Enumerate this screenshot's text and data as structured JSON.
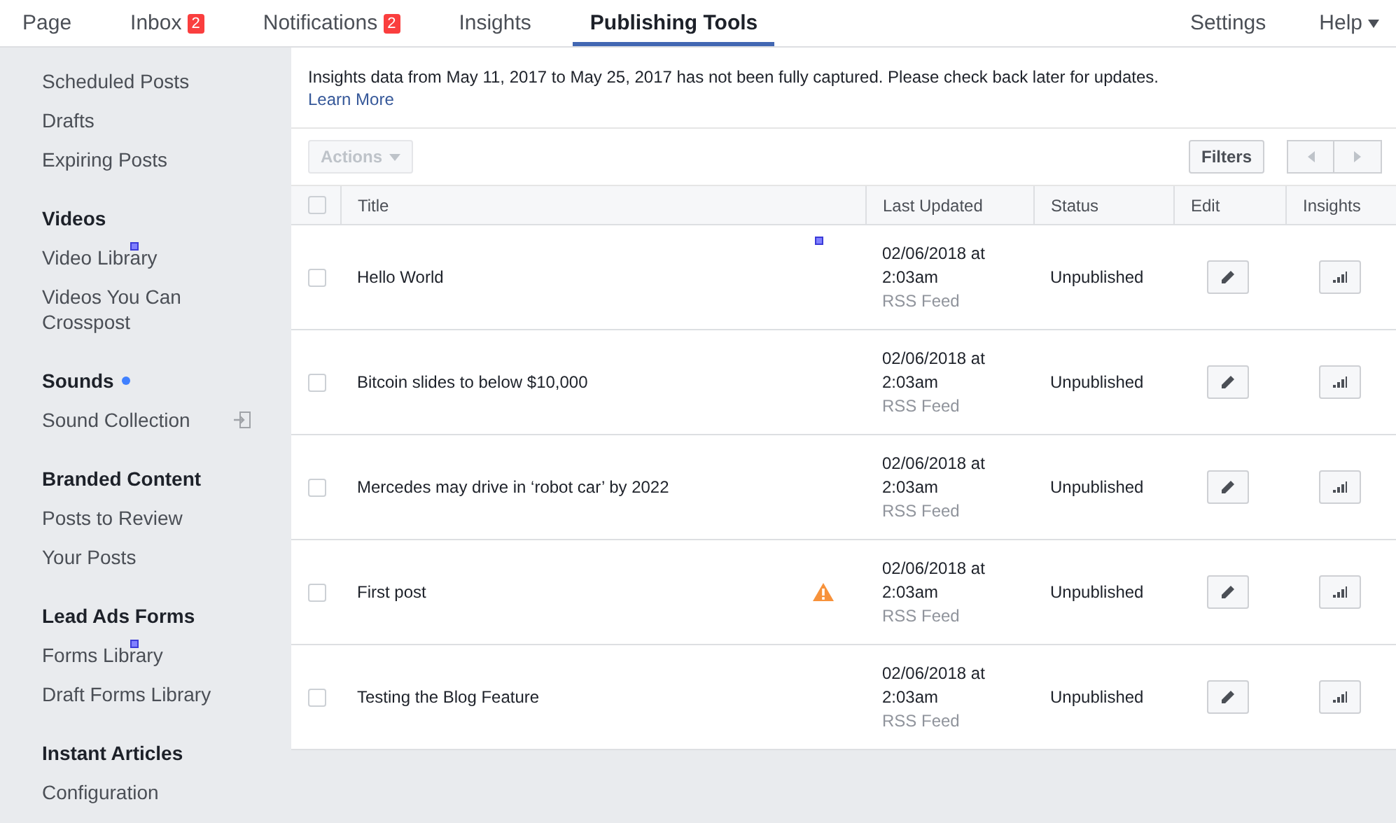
{
  "nav": {
    "tabs": [
      {
        "label": "Page",
        "selected": false
      },
      {
        "label": "Inbox",
        "badge": "2",
        "selected": false
      },
      {
        "label": "Notifications",
        "badge": "2",
        "selected": false
      },
      {
        "label": "Insights",
        "selected": false
      },
      {
        "label": "Publishing Tools",
        "selected": true
      }
    ],
    "right": [
      {
        "label": "Settings",
        "kind": "plain"
      },
      {
        "label": "Help",
        "kind": "menu"
      }
    ]
  },
  "sidebar": {
    "sections": [
      {
        "items": [
          {
            "label": "Scheduled Posts",
            "marker": false
          },
          {
            "label": "Drafts",
            "marker": false
          },
          {
            "label": "Expiring Posts",
            "marker": false
          }
        ]
      },
      {
        "heading": "Videos",
        "new_dot": false,
        "items": [
          {
            "label": "Video Library",
            "marker": true
          },
          {
            "label": "Videos You Can Crosspost",
            "marker": false
          }
        ]
      },
      {
        "heading": "Sounds",
        "new_dot": true,
        "items": [
          {
            "label": "Sound Collection",
            "marker": false,
            "external": true
          }
        ]
      },
      {
        "heading": "Branded Content",
        "new_dot": false,
        "items": [
          {
            "label": "Posts to Review",
            "marker": false
          },
          {
            "label": "Your Posts",
            "marker": false
          }
        ]
      },
      {
        "heading": "Lead Ads Forms",
        "new_dot": false,
        "items": [
          {
            "label": "Forms Library",
            "marker": true
          },
          {
            "label": "Draft Forms Library",
            "marker": false
          }
        ]
      },
      {
        "heading": "Instant Articles",
        "new_dot": false,
        "items": [
          {
            "label": "Configuration",
            "marker": false
          }
        ]
      }
    ]
  },
  "notice": {
    "text": "Insights data from May 11, 2017 to May 25, 2017 has not been fully captured. Please check back later for updates.",
    "link": "Learn More"
  },
  "toolbar": {
    "actions": {
      "label": "Actions",
      "disabled": true
    },
    "filters": "Filters"
  },
  "table": {
    "select_all": {
      "checked": false
    },
    "columns": [
      "Title",
      "Last Updated",
      "Status",
      "Edit",
      "Insights"
    ],
    "rows": [
      {
        "title": "Hello World",
        "marker": true,
        "warning": false,
        "updated": "02/06/2018 at 2:03am",
        "source": "RSS Feed",
        "status": "Unpublished",
        "checked": false
      },
      {
        "title": "Bitcoin slides to below $10,000",
        "marker": false,
        "warning": false,
        "updated": "02/06/2018 at 2:03am",
        "source": "RSS Feed",
        "status": "Unpublished",
        "checked": false
      },
      {
        "title": "Mercedes may drive in ‘robot car’ by 2022",
        "marker": false,
        "warning": false,
        "updated": "02/06/2018 at 2:03am",
        "source": "RSS Feed",
        "status": "Unpublished",
        "checked": false
      },
      {
        "title": "First post",
        "marker": false,
        "warning": true,
        "updated": "02/06/2018 at 2:03am",
        "source": "RSS Feed",
        "status": "Unpublished",
        "checked": false
      },
      {
        "title": "Testing the Blog Feature",
        "marker": false,
        "warning": false,
        "updated": "02/06/2018 at 2:03am",
        "source": "RSS Feed",
        "status": "Unpublished",
        "checked": false
      }
    ]
  }
}
